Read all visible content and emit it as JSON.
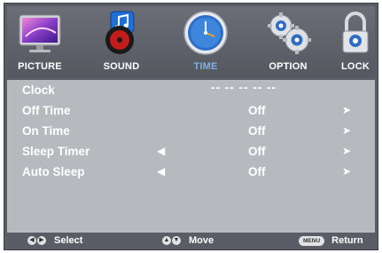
{
  "tabs": [
    {
      "label": "PICTURE",
      "icon": "monitor-icon",
      "active": false
    },
    {
      "label": "SOUND",
      "icon": "music-note-icon",
      "active": false
    },
    {
      "label": "TIME",
      "icon": "clock-icon",
      "active": true
    },
    {
      "label": "OPTION",
      "icon": "gears-icon",
      "active": false
    },
    {
      "label": "LOCK",
      "icon": "padlock-icon",
      "active": false
    }
  ],
  "menu": {
    "clock": {
      "label": "Clock",
      "value": "-- -- --  -- --"
    },
    "rows": [
      {
        "label": "Off Time",
        "value": "Off"
      },
      {
        "label": "On Time",
        "value": "Off"
      },
      {
        "label": "Sleep Timer",
        "value": "Off"
      },
      {
        "label": "Auto Sleep",
        "value": "Off"
      }
    ]
  },
  "help": {
    "select": "Select",
    "move": "Move",
    "menu_key": "MENU",
    "return": "Return"
  },
  "colors": {
    "frame": "#5a5d66",
    "panel": "#b7b9bf",
    "active_tab_label": "#7fb0e6"
  }
}
